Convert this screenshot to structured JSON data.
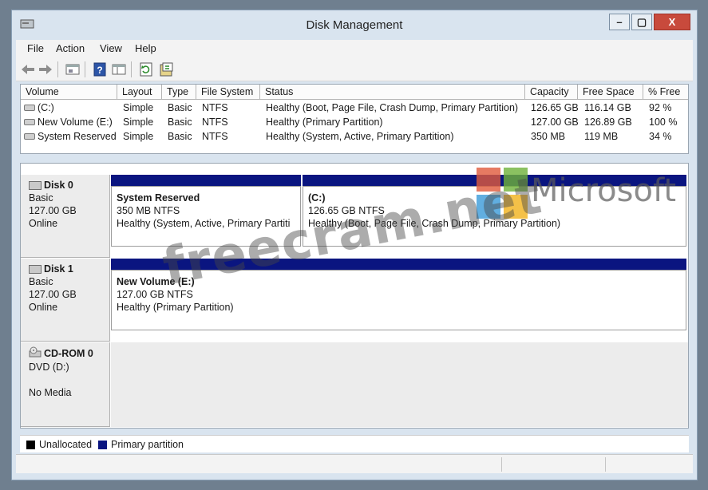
{
  "window": {
    "title": "Disk Management",
    "controls": {
      "minimize": "–",
      "restore": "▢",
      "close": "X"
    }
  },
  "menu": [
    {
      "label": "File"
    },
    {
      "label": "Action"
    },
    {
      "label": "View"
    },
    {
      "label": "Help"
    }
  ],
  "toolbar_icons": [
    "back-arrow-icon",
    "forward-arrow-icon",
    "properties-icon",
    "help-icon",
    "console-tree-icon",
    "refresh-icon",
    "rescan-icon"
  ],
  "volume_table": {
    "columns": [
      "Volume",
      "Layout",
      "Type",
      "File System",
      "Status",
      "Capacity",
      "Free Space",
      "% Free"
    ],
    "rows": [
      {
        "volume": "(C:)",
        "layout": "Simple",
        "type": "Basic",
        "fs": "NTFS",
        "status": "Healthy (Boot, Page File, Crash Dump, Primary Partition)",
        "capacity": "126.65 GB",
        "free": "116.14 GB",
        "pct": "92 %"
      },
      {
        "volume": "New Volume (E:)",
        "layout": "Simple",
        "type": "Basic",
        "fs": "NTFS",
        "status": "Healthy (Primary Partition)",
        "capacity": "127.00 GB",
        "free": "126.89 GB",
        "pct": "100 %"
      },
      {
        "volume": "System Reserved",
        "layout": "Simple",
        "type": "Basic",
        "fs": "NTFS",
        "status": "Healthy (System, Active, Primary Partition)",
        "capacity": "350 MB",
        "free": "119 MB",
        "pct": "34 %"
      }
    ]
  },
  "disks": [
    {
      "name": "Disk 0",
      "type": "Basic",
      "size": "127.00 GB",
      "state": "Online",
      "partitions": [
        {
          "name": "System Reserved",
          "size": "350 MB NTFS",
          "status": "Healthy (System, Active, Primary Partiti"
        },
        {
          "name": "(C:)",
          "size": "126.65 GB NTFS",
          "status": "Healthy (Boot, Page File, Crash Dump, Primary Partition)"
        }
      ]
    },
    {
      "name": "Disk 1",
      "type": "Basic",
      "size": "127.00 GB",
      "state": "Online",
      "partitions": [
        {
          "name": "New Volume  (E:)",
          "size": "127.00 GB NTFS",
          "status": "Healthy (Primary Partition)"
        }
      ]
    },
    {
      "name": "CD-ROM 0",
      "type": "DVD (D:)",
      "size": "",
      "state": "No Media",
      "partitions": []
    }
  ],
  "legend": [
    {
      "label": "Unallocated",
      "color": "#000000"
    },
    {
      "label": "Primary partition",
      "color": "#0a1580"
    }
  ],
  "watermark": {
    "text": "freecram.net",
    "brand": "Microsoft"
  }
}
